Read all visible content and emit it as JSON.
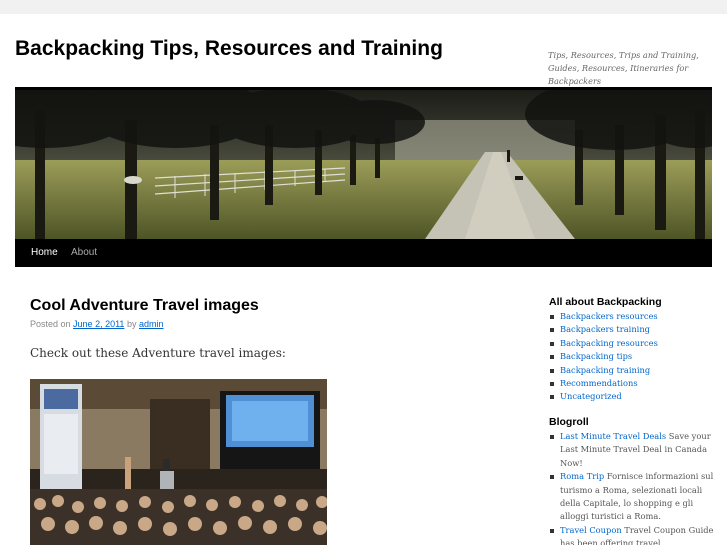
{
  "site": {
    "title": "Backpacking Tips, Resources and Training",
    "description": "Tips, Resources, Trips and Training, Guides, Resources, Itineraries for Backpackers"
  },
  "nav": {
    "items": [
      {
        "label": "Home"
      },
      {
        "label": "About"
      }
    ]
  },
  "post": {
    "title": "Cool Adventure Travel images",
    "meta": {
      "posted_on": "Posted on",
      "date": "June 2, 2011",
      "by": "by",
      "author": "admin"
    },
    "content": "Check out these Adventure travel images:"
  },
  "sidebar": {
    "categories": {
      "title": "All about Backpacking",
      "items": [
        {
          "label": "Backpackers resources"
        },
        {
          "label": "Backpackers training"
        },
        {
          "label": "Backpacking resources"
        },
        {
          "label": "Backpacking tips"
        },
        {
          "label": "Backpacking training"
        },
        {
          "label": "Recommendations"
        },
        {
          "label": "Uncategorized"
        }
      ]
    },
    "blogroll": {
      "title": "Blogroll",
      "items": [
        {
          "label": "Last Minute Travel Deals",
          "desc": " Save your Last Minute Travel Deal in Canada Now!"
        },
        {
          "label": "Roma Trip",
          "desc": " Fornisce informazioni sul turismo a Roma, selezionati locali della Capitale, lo shopping e gli alloggi turistici a Roma."
        },
        {
          "label": "Travel Coupon",
          "desc": " Travel Coupon Guide has been offering travel"
        }
      ]
    }
  },
  "colors": {
    "link": "#0066cc",
    "nav_bg": "#000000",
    "title": "#000000"
  }
}
